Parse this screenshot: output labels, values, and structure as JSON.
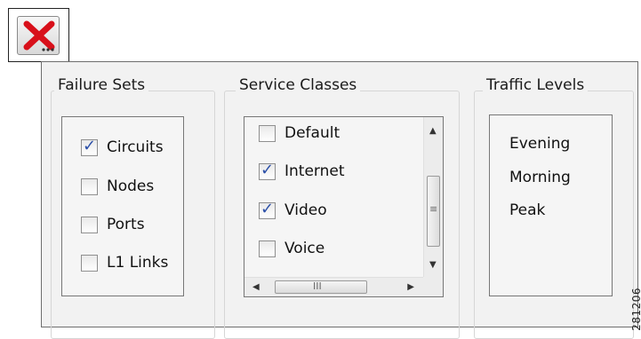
{
  "toolbar": {
    "close_icon": "red-x-icon"
  },
  "failure_sets": {
    "title": "Failure Sets",
    "items": [
      {
        "label": "Circuits",
        "checked": true
      },
      {
        "label": "Nodes",
        "checked": false
      },
      {
        "label": "Ports",
        "checked": false
      },
      {
        "label": "L1 Links",
        "checked": false
      }
    ]
  },
  "service_classes": {
    "title": "Service Classes",
    "items": [
      {
        "label": "Default",
        "checked": false
      },
      {
        "label": "Internet",
        "checked": true
      },
      {
        "label": "Video",
        "checked": true
      },
      {
        "label": "Voice",
        "checked": false
      }
    ]
  },
  "traffic_levels": {
    "title": "Traffic Levels",
    "items": [
      "Evening",
      "Morning",
      "Peak"
    ]
  },
  "figure_id": "281206",
  "colors": {
    "panel_bg": "#f2f2f2",
    "check": "#2b4fa8",
    "close_red": "#d8101a"
  }
}
